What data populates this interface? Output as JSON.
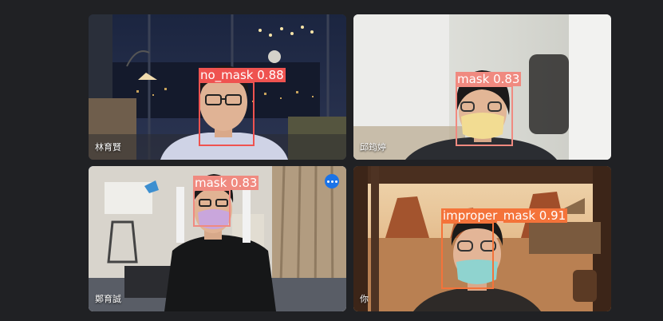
{
  "colors": {
    "no_mask": "#ef5350",
    "mask": "#f08a80",
    "improper_mask": "#f4733a",
    "active_outline": "#8ab4f8",
    "more_button": "#1a73e8"
  },
  "participants": [
    {
      "name": "林育賢",
      "detection": {
        "label": "no_mask 0.88",
        "class": "no_mask",
        "score": 0.88
      }
    },
    {
      "name": "邱筠婷",
      "detection": {
        "label": "mask 0.83",
        "class": "mask",
        "score": 0.83
      }
    },
    {
      "name": "鄭育誠",
      "active": true,
      "more_icon": "more-horizontal-icon",
      "detection": {
        "label": "mask 0.83",
        "class": "mask",
        "score": 0.83
      }
    },
    {
      "name": "你",
      "detection": {
        "label": "improper_mask 0.91",
        "class": "improper_mask",
        "score": 0.91
      }
    }
  ]
}
